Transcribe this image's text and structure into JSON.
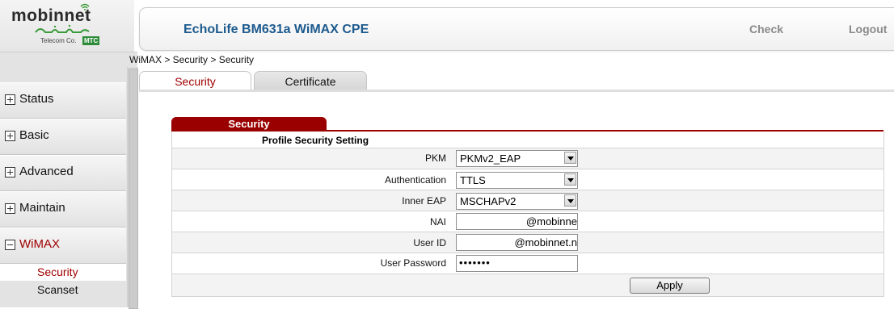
{
  "logo": {
    "brand": "mobinnet",
    "tagline": "Telecom Co.",
    "badge": "MTC"
  },
  "header": {
    "title": "EchoLife BM631a WiMAX CPE",
    "check_label": "Check",
    "logout_label": "Logout"
  },
  "sidebar": {
    "items": [
      {
        "label": "Status"
      },
      {
        "label": "Basic"
      },
      {
        "label": "Advanced"
      },
      {
        "label": "Maintain"
      },
      {
        "label": "WiMAX"
      }
    ],
    "subitems": [
      {
        "label": "Security"
      },
      {
        "label": "Scanset"
      }
    ]
  },
  "breadcrumb": "WiMAX > Security > Security",
  "tabs": [
    {
      "label": "Security"
    },
    {
      "label": "Certificate"
    }
  ],
  "section": {
    "title": "Security",
    "subheading": "Profile Security Setting",
    "fields": {
      "pkm": {
        "label": "PKM",
        "value": "PKMv2_EAP"
      },
      "authentication": {
        "label": "Authentication",
        "value": "TTLS"
      },
      "inner_eap": {
        "label": "Inner EAP",
        "value": "MSCHAPv2"
      },
      "nai": {
        "label": "NAI",
        "value": "@mobinne"
      },
      "user_id": {
        "label": "User ID",
        "value": "@mobinnet.n"
      },
      "user_password": {
        "label": "User Password",
        "value": "•••••••"
      }
    },
    "apply_label": "Apply"
  },
  "colors": {
    "accent": "#9a0000",
    "header_title": "#1d5a8e",
    "header_links": "#8a8a8a"
  }
}
